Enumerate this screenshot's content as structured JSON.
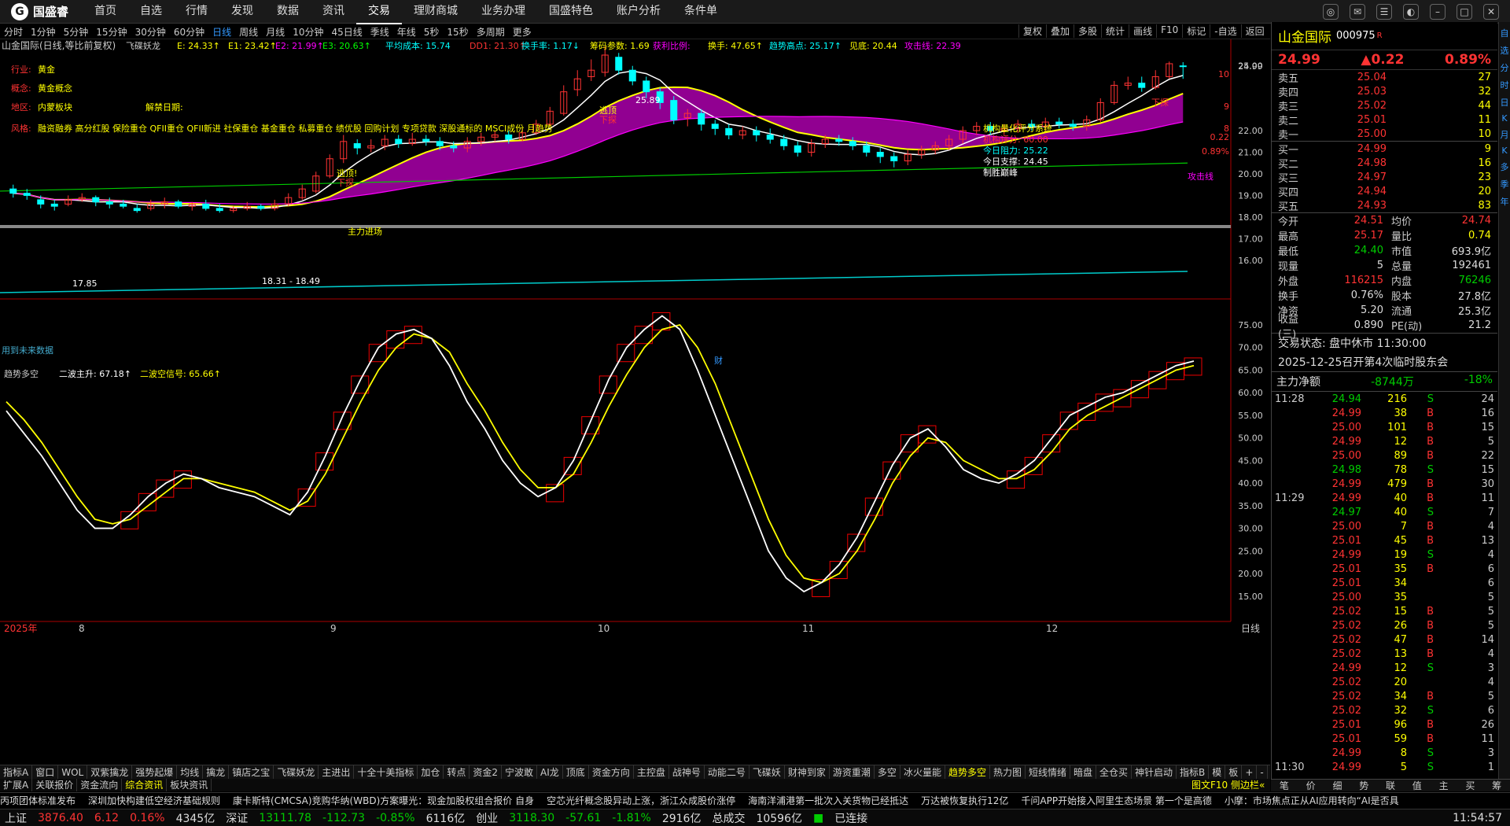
{
  "app": {
    "logo": "国盛睿"
  },
  "nav": [
    "首页",
    "自选",
    "行情",
    "发现",
    "数据",
    "资讯",
    "交易",
    "理财商城",
    "业务办理",
    "国盛特色",
    "账户分析",
    "条件单"
  ],
  "periods": [
    "分时",
    "1分钟",
    "5分钟",
    "15分钟",
    "30分钟",
    "60分钟",
    "日线",
    "周线",
    "月线",
    "10分钟",
    "45日线",
    "季线",
    "年线",
    "5秒",
    "15秒",
    "多周期",
    "更多"
  ],
  "tools": [
    "复权",
    "叠加",
    "多股",
    "统计",
    "画线",
    "F10",
    "标记",
    "-自选",
    "返回"
  ],
  "chart_info": {
    "title": "山金国际(日线,等比前复权)",
    "ind": "飞碟妖龙",
    "E": "E: 24.33↑",
    "E1": "E1: 23.42↑",
    "E2": "E2: 21.99↑",
    "E3": "E3: 20.63↑",
    "cost": "平均成本: 15.74",
    "dd1": "DD1: 21.30↑",
    "turn": "换手率: 1.17↓",
    "chip": "筹码参数: 1.69",
    "profit": "获利比例:",
    "hs": "换手: 47.65↑",
    "trend_high": "趋势高点: 25.17↑",
    "low": "见底: 20.44",
    "attack": "攻击线: 22.39"
  },
  "labels": {
    "industry": "行业:",
    "industry_v": "黄金",
    "concept": "概念:",
    "concept_v": "黄金概念",
    "region": "地区:",
    "region_v": "内蒙板块",
    "unlock": "解禁日期:",
    "style": "风格:",
    "style_v": "融资融券 高分红股 保险重仓 QFII重仓 QFII新进 社保重仓 基金重仓 私募重仓 绩优股 回购计划 专项贷款 深股通标的 MSCI成份 月趋势",
    "quant": "机构量化评分系统",
    "score": "机构评分: 60.00",
    "resist": "今日阻力: 25.22",
    "support": "今日支撑: 24.45",
    "peak": "制胜巅峰",
    "escape1": "逃顶!",
    "down1": "下探",
    "escape2": "逃顶",
    "down2": "下探",
    "down3": "下探",
    "main": "主力进场",
    "hi": "25.89",
    "lo": "17.85",
    "range": "18.31 - 18.49",
    "bottom_msg": "用到未来数据",
    "cai": "财",
    "attack_line": "攻击线"
  },
  "yaxis_top": [
    "25.00",
    "24.99",
    "24.99",
    "22.00",
    "21.00",
    "20.00",
    "19.00",
    "18.00",
    "17.00",
    "16.00"
  ],
  "yaxis_right_small": [
    "10",
    "9",
    "8",
    "0.22",
    "0.89%"
  ],
  "sub": {
    "title": "趋势多空",
    "l1": "二波主升: 67.18↑",
    "l2": "二波空信号: 65.66↑"
  },
  "yaxis_bot": [
    "75.00",
    "70.00",
    "65.00",
    "60.00",
    "55.00",
    "50.00",
    "45.00",
    "40.00",
    "35.00",
    "30.00",
    "25.00",
    "20.00",
    "15.00"
  ],
  "xaxis": [
    "2025年",
    "8",
    "9",
    "10",
    "11",
    "12"
  ],
  "xaxis_right": "日线",
  "stock": {
    "name": "山金国际",
    "code": "000975",
    "r": "R",
    "price": "24.99",
    "change": "▲0.22",
    "pct": "0.89%"
  },
  "asks": [
    [
      "卖五",
      "25.04",
      "27"
    ],
    [
      "卖四",
      "25.03",
      "32"
    ],
    [
      "卖三",
      "25.02",
      "44"
    ],
    [
      "卖二",
      "25.01",
      "11"
    ],
    [
      "卖一",
      "25.00",
      "10"
    ]
  ],
  "bids": [
    [
      "买一",
      "24.99",
      "9"
    ],
    [
      "买二",
      "24.98",
      "16"
    ],
    [
      "买三",
      "24.97",
      "23"
    ],
    [
      "买四",
      "24.94",
      "20"
    ],
    [
      "买五",
      "24.93",
      "83"
    ]
  ],
  "stats": [
    [
      "今开",
      "24.51",
      "均价",
      "24.74"
    ],
    [
      "最高",
      "25.17",
      "量比",
      "0.74"
    ],
    [
      "最低",
      "24.40",
      "市值",
      "693.9亿"
    ],
    [
      "现量",
      "5",
      "总量",
      "192461"
    ],
    [
      "外盘",
      "116215",
      "内盘",
      "76246"
    ],
    [
      "换手",
      "0.76%",
      "股本",
      "27.8亿"
    ],
    [
      "净资",
      "5.20",
      "流通",
      "25.3亿"
    ],
    [
      "收益(三)",
      "0.890",
      "PE(动)",
      "21.2"
    ]
  ],
  "trade_state": "交易状态: 盘中休市 11:30:00",
  "event": "2025-12-25召开第4次临时股东会",
  "mflow": {
    "label": "主力净额",
    "val": "-8744万",
    "pct": "-18%"
  },
  "ticks": [
    [
      "11:28",
      "24.94",
      "216",
      "S",
      "24"
    ],
    [
      "",
      "24.99",
      "38",
      "B",
      "16"
    ],
    [
      "",
      "25.00",
      "101",
      "B",
      "15"
    ],
    [
      "",
      "24.99",
      "12",
      "B",
      "5"
    ],
    [
      "",
      "25.00",
      "89",
      "B",
      "22"
    ],
    [
      "",
      "24.98",
      "78",
      "S",
      "15"
    ],
    [
      "",
      "24.99",
      "479",
      "B",
      "30"
    ],
    [
      "11:29",
      "24.99",
      "40",
      "B",
      "11"
    ],
    [
      "",
      "24.97",
      "40",
      "S",
      "7"
    ],
    [
      "",
      "25.00",
      "7",
      "B",
      "4"
    ],
    [
      "",
      "25.01",
      "45",
      "B",
      "13"
    ],
    [
      "",
      "24.99",
      "19",
      "S",
      "4"
    ],
    [
      "",
      "25.01",
      "35",
      "B",
      "6"
    ],
    [
      "",
      "25.01",
      "34",
      "",
      "6"
    ],
    [
      "",
      "25.00",
      "35",
      "",
      "5"
    ],
    [
      "",
      "25.02",
      "15",
      "B",
      "5"
    ],
    [
      "",
      "25.02",
      "26",
      "B",
      "5"
    ],
    [
      "",
      "25.02",
      "47",
      "B",
      "14"
    ],
    [
      "",
      "25.02",
      "13",
      "B",
      "4"
    ],
    [
      "",
      "24.99",
      "12",
      "S",
      "3"
    ],
    [
      "",
      "25.02",
      "20",
      "",
      "4"
    ],
    [
      "",
      "25.02",
      "34",
      "B",
      "5"
    ],
    [
      "",
      "25.02",
      "32",
      "S",
      "6"
    ],
    [
      "",
      "25.01",
      "96",
      "B",
      "26"
    ],
    [
      "",
      "25.01",
      "59",
      "B",
      "11"
    ],
    [
      "",
      "24.99",
      "8",
      "S",
      "3"
    ],
    [
      "11:30",
      "24.99",
      "5",
      "S",
      "1"
    ]
  ],
  "rtabs": [
    "笔",
    "价",
    "细",
    "势",
    "联",
    "值",
    "主",
    "买",
    "筹"
  ],
  "rside": [
    "自",
    "选",
    "分",
    "时",
    "日",
    "K",
    "月",
    "K",
    "多",
    "季",
    "年"
  ],
  "btabs": [
    "指标A",
    "窗口",
    "WOL",
    "双紫擒龙",
    "强势起爆",
    "均线",
    "擒龙",
    "镇店之宝",
    "飞碟妖龙",
    "主进出",
    "十全十美指标",
    "加仓",
    "转点",
    "资金2",
    "宁波敢",
    "AI龙",
    "顶底",
    "资金方向",
    "主控盘",
    "战神号",
    "动能二号",
    "飞碟妖",
    "财神到家",
    "游资重潮",
    "多空",
    "冰火量能",
    "趋势多空",
    "热力图",
    "短线情绪",
    "暗盘",
    "全仓买",
    "神针启动",
    "指标B",
    "模",
    "板",
    "+",
    "-"
  ],
  "btabs_on": "趋势多空",
  "subtabs": [
    "扩展A",
    "关联报价",
    "资金流向",
    "综合资讯",
    "板块资讯"
  ],
  "subtabs_on": "综合资讯",
  "right_small": "图文F10 侧边栏«",
  "news": [
    "丙项团体标准发布",
    "深圳加快构建低空经济基础规则",
    "康卡斯特(CMCSA)竞购华纳(WBD)方案曝光：现金加股权组合报价 自身",
    "空芯光纤概念股异动上涨，浙江众成股价涨停",
    "海南洋浦港第一批次入关货物已经抵达",
    "万达被恢复执行12亿",
    "千问APP开始接入阿里生态场景 第一个是高德",
    "小摩：市场焦点正从AI应用转向“AI是否具"
  ],
  "status": {
    "sh": "上证",
    "sh_v": "3876.40",
    "sh_c": "6.12",
    "sh_p": "0.16%",
    "sh_a": "4345亿",
    "sz": "深证",
    "sz_v": "13111.78",
    "sz_c": "-112.73",
    "sz_p": "-0.85%",
    "sz_a": "6116亿",
    "cy": "创业",
    "cy_v": "3118.30",
    "cy_c": "-57.61",
    "cy_p": "-1.81%",
    "cy_a": "2916亿",
    "tot": "总成交",
    "tot_v": "10596亿",
    "conn": "已连接",
    "time": "11:54:57"
  },
  "chart_data": {
    "type": "candlestick",
    "price_ylim": [
      15.3,
      25.5
    ],
    "sub_ylim": [
      12,
      79
    ],
    "candles": [
      [
        19.3,
        19.1,
        19.5,
        18.9
      ],
      [
        19.1,
        19.0,
        19.3,
        18.8
      ],
      [
        18.8,
        18.6,
        19.0,
        18.4
      ],
      [
        18.6,
        18.5,
        18.8,
        18.3
      ],
      [
        18.6,
        18.8,
        19.0,
        18.5
      ],
      [
        18.8,
        18.9,
        19.1,
        18.7
      ],
      [
        18.9,
        18.7,
        19.0,
        18.5
      ],
      [
        18.7,
        18.6,
        18.9,
        18.4
      ],
      [
        18.6,
        18.5,
        18.8,
        18.4
      ],
      [
        18.4,
        18.3,
        18.6,
        18.2
      ],
      [
        18.4,
        18.6,
        18.8,
        18.3
      ],
      [
        18.6,
        18.7,
        18.9,
        18.4
      ],
      [
        18.7,
        18.5,
        18.8,
        18.4
      ],
      [
        18.5,
        18.6,
        18.7,
        18.3
      ],
      [
        18.6,
        18.4,
        18.8,
        18.3
      ],
      [
        18.4,
        18.3,
        18.6,
        18.2
      ],
      [
        18.3,
        18.4,
        18.5,
        18.2
      ],
      [
        18.4,
        18.5,
        18.7,
        18.3
      ],
      [
        18.5,
        18.4,
        18.6,
        18.3
      ],
      [
        18.4,
        18.6,
        18.8,
        18.3
      ],
      [
        18.6,
        18.9,
        19.1,
        18.5
      ],
      [
        18.9,
        19.3,
        19.5,
        18.8
      ],
      [
        19.2,
        19.9,
        20.1,
        19.1
      ],
      [
        19.9,
        20.7,
        20.9,
        19.8
      ],
      [
        20.7,
        21.5,
        21.8,
        20.5
      ],
      [
        21.4,
        21.2,
        21.6,
        20.9
      ],
      [
        21.2,
        21.3,
        21.6,
        21.0
      ],
      [
        21.3,
        21.6,
        21.8,
        21.1
      ],
      [
        21.6,
        21.4,
        21.8,
        21.2
      ],
      [
        21.4,
        21.6,
        21.9,
        21.3
      ],
      [
        21.6,
        21.5,
        21.8,
        21.3
      ],
      [
        21.5,
        21.3,
        21.7,
        21.1
      ],
      [
        21.3,
        21.2,
        21.5,
        21.0
      ],
      [
        21.2,
        21.5,
        21.7,
        21.0
      ],
      [
        21.5,
        21.7,
        21.9,
        21.3
      ],
      [
        21.7,
        21.8,
        22.0,
        21.5
      ],
      [
        21.8,
        21.6,
        22.0,
        21.4
      ],
      [
        21.6,
        21.9,
        22.1,
        21.5
      ],
      [
        21.9,
        22.3,
        22.5,
        21.8
      ],
      [
        22.3,
        22.9,
        23.1,
        22.2
      ],
      [
        22.8,
        23.8,
        24.1,
        22.7
      ],
      [
        23.9,
        24.4,
        24.8,
        23.6
      ],
      [
        24.5,
        24.8,
        25.3,
        24.3
      ],
      [
        24.7,
        25.5,
        25.9,
        24.5
      ],
      [
        25.4,
        24.8,
        25.6,
        24.6
      ],
      [
        24.8,
        24.3,
        25.0,
        24.1
      ],
      [
        24.3,
        23.8,
        24.5,
        23.5
      ],
      [
        23.8,
        23.3,
        24.0,
        23.0
      ],
      [
        23.4,
        22.5,
        23.6,
        22.3
      ],
      [
        22.6,
        22.8,
        23.0,
        22.2
      ],
      [
        22.8,
        22.3,
        23.0,
        22.0
      ],
      [
        22.3,
        22.1,
        22.5,
        21.8
      ],
      [
        22.1,
        21.8,
        22.3,
        21.6
      ],
      [
        21.8,
        22.0,
        22.2,
        21.6
      ],
      [
        22.0,
        21.8,
        22.2,
        21.5
      ],
      [
        21.8,
        21.6,
        22.1,
        21.4
      ],
      [
        21.6,
        21.3,
        21.8,
        21.1
      ],
      [
        21.3,
        21.0,
        21.5,
        20.8
      ],
      [
        21.0,
        21.4,
        21.6,
        20.8
      ],
      [
        21.4,
        21.6,
        21.8,
        21.2
      ],
      [
        21.6,
        21.5,
        21.8,
        21.3
      ],
      [
        21.5,
        21.3,
        21.7,
        21.1
      ],
      [
        21.3,
        21.0,
        21.5,
        20.8
      ],
      [
        21.0,
        20.8,
        21.2,
        20.5
      ],
      [
        20.8,
        20.6,
        21.0,
        20.3
      ],
      [
        20.6,
        20.9,
        21.1,
        20.4
      ],
      [
        20.9,
        21.1,
        21.3,
        20.7
      ],
      [
        21.1,
        21.3,
        21.5,
        20.9
      ],
      [
        21.3,
        21.6,
        21.8,
        21.1
      ],
      [
        21.6,
        22.0,
        22.2,
        21.4
      ],
      [
        22.0,
        22.2,
        22.4,
        21.8
      ],
      [
        22.2,
        22.0,
        22.4,
        21.8
      ],
      [
        22.0,
        22.1,
        22.3,
        21.8
      ],
      [
        22.1,
        22.3,
        22.5,
        21.9
      ],
      [
        22.3,
        22.2,
        22.5,
        22.0
      ],
      [
        22.2,
        22.4,
        22.6,
        22.0
      ],
      [
        22.4,
        22.3,
        22.6,
        22.1
      ],
      [
        22.3,
        22.2,
        22.5,
        22.0
      ],
      [
        22.2,
        22.5,
        22.7,
        22.0
      ],
      [
        22.5,
        23.3,
        23.5,
        22.4
      ],
      [
        23.3,
        24.1,
        24.3,
        23.2
      ],
      [
        24.1,
        24.2,
        24.5,
        23.9
      ],
      [
        24.2,
        24.0,
        24.5,
        23.8
      ],
      [
        24.0,
        24.5,
        24.8,
        23.9
      ],
      [
        24.5,
        25.1,
        25.2,
        24.4
      ],
      [
        25.0,
        24.99,
        25.17,
        24.4
      ]
    ],
    "sub_white": [
      56,
      51,
      46,
      40,
      34,
      30,
      30,
      33,
      37,
      40,
      42,
      41,
      39,
      38,
      37,
      35,
      33,
      38,
      46,
      55,
      63,
      70,
      73,
      74,
      72,
      66,
      58,
      52,
      45,
      40,
      37,
      39,
      45,
      54,
      63,
      70,
      74,
      77,
      74,
      65,
      55,
      45,
      35,
      25,
      19,
      16,
      18,
      22,
      28,
      36,
      44,
      50,
      52,
      48,
      43,
      41,
      40,
      42,
      45,
      50,
      55,
      57,
      59,
      60,
      62,
      64,
      66,
      67
    ],
    "sub_yellow": [
      58,
      54,
      49,
      43,
      37,
      32,
      31,
      32,
      35,
      38,
      41,
      41,
      40,
      39,
      38,
      36,
      34,
      36,
      42,
      50,
      58,
      65,
      70,
      73,
      72,
      69,
      62,
      56,
      49,
      43,
      39,
      39,
      42,
      49,
      57,
      64,
      70,
      74,
      75,
      70,
      62,
      52,
      42,
      32,
      24,
      19,
      18,
      20,
      25,
      32,
      40,
      46,
      50,
      49,
      45,
      43,
      41,
      41,
      43,
      47,
      52,
      55,
      57,
      59,
      61,
      63,
      65,
      66
    ]
  }
}
